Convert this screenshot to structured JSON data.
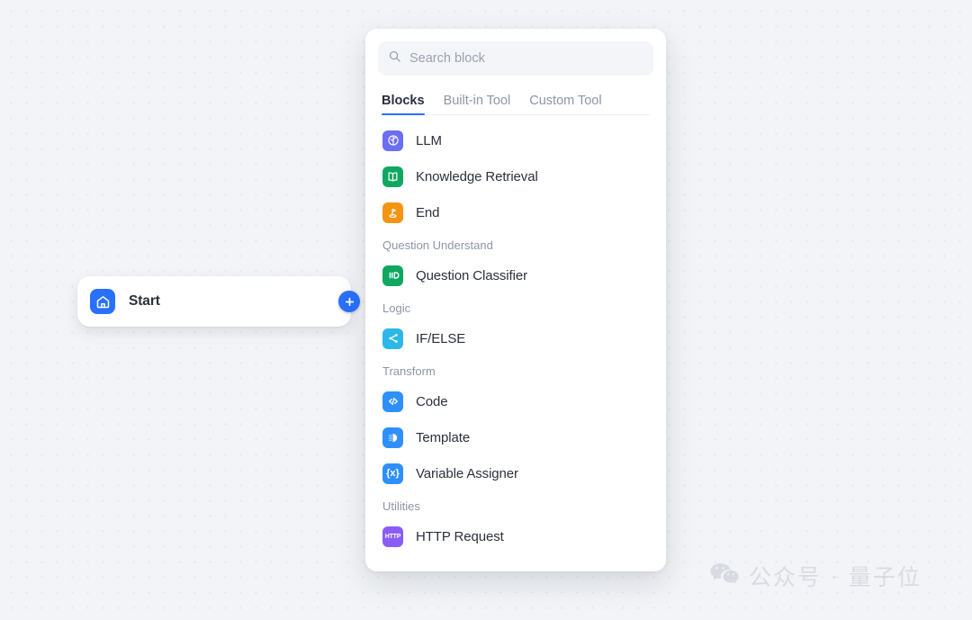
{
  "canvas": {
    "background_color": "#f2f4f7",
    "dot_color": "#e3e6ec"
  },
  "start_node": {
    "title": "Start",
    "icon": "home-icon",
    "icon_color": "#2970ff",
    "add_handle_icon": "plus-icon",
    "add_handle_color": "#2970ff"
  },
  "panel": {
    "search": {
      "placeholder": "Search block",
      "value": "",
      "icon": "search-icon"
    },
    "tabs": [
      {
        "label": "Blocks",
        "active": true
      },
      {
        "label": "Built-in Tool",
        "active": false
      },
      {
        "label": "Custom Tool",
        "active": false
      }
    ],
    "active_tab_underline_color": "#2970ff",
    "groups": [
      {
        "label": "",
        "items": [
          {
            "label": "LLM",
            "icon": "llm-icon",
            "color": "#6a6ef0"
          },
          {
            "label": "Knowledge Retrieval",
            "icon": "book-icon",
            "color": "#10a861"
          },
          {
            "label": "End",
            "icon": "end-flag-icon",
            "color": "#f59413"
          }
        ]
      },
      {
        "label": "Question Understand",
        "items": [
          {
            "label": "Question Classifier",
            "icon": "classifier-icon",
            "color": "#10a861"
          }
        ]
      },
      {
        "label": "Logic",
        "items": [
          {
            "label": "IF/ELSE",
            "icon": "branch-icon",
            "color": "#2bb8e8"
          }
        ]
      },
      {
        "label": "Transform",
        "items": [
          {
            "label": "Code",
            "icon": "code-icon",
            "color": "#2e90fa"
          },
          {
            "label": "Template",
            "icon": "template-icon",
            "color": "#2e90fa"
          },
          {
            "label": "Variable Assigner",
            "icon": "variable-icon",
            "color": "#2e90fa"
          }
        ]
      },
      {
        "label": "Utilities",
        "items": [
          {
            "label": "HTTP Request",
            "icon": "http-icon",
            "color": "#8b5cf6",
            "badge_text": "HTTP"
          }
        ]
      }
    ]
  },
  "watermark": {
    "text": "公众号 · 量子位",
    "icon": "wechat-icon"
  }
}
